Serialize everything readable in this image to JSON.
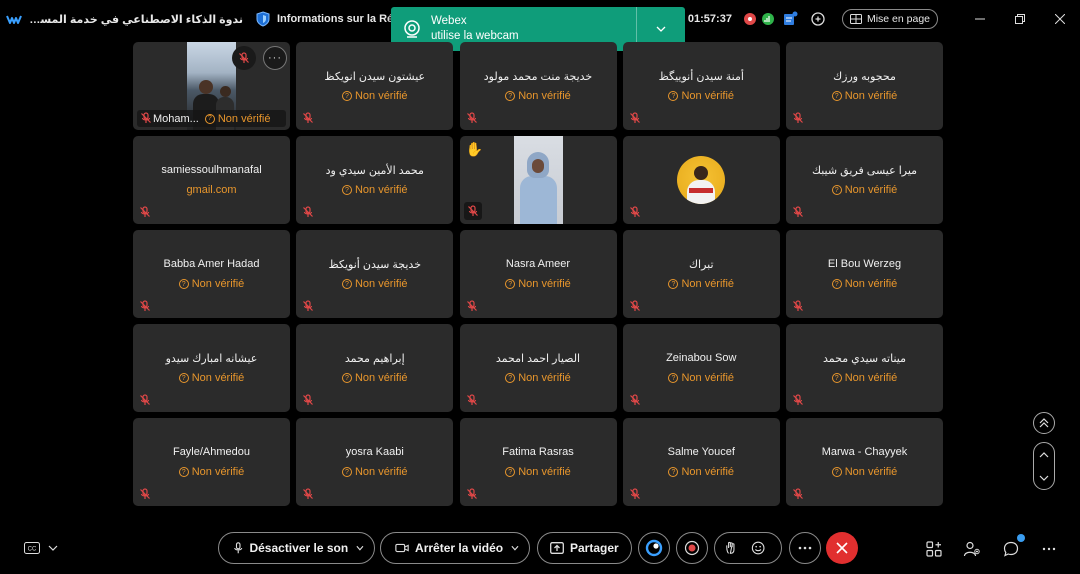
{
  "titlebar": {
    "meeting_title": "ندوة الذكاء الاصطناعي في خدمة المساواة: آفاق المن...",
    "info_label": "Informations sur la Réunion",
    "clock": "01:57:37",
    "layout_label": "Mise en page"
  },
  "toast": {
    "title": "Webex",
    "message": "utilise la webcam"
  },
  "status_text": "Non vérifié",
  "tiles": [
    {
      "name": "Moham...",
      "status": "Non vérifié",
      "type": "video-host"
    },
    {
      "name": "عيشتون سيدن انويكظ",
      "status": "Non vérifié"
    },
    {
      "name": "خديجة منت محمد مولود",
      "status": "Non vérifié"
    },
    {
      "name": "أمنة سيدن أنوييگظ",
      "status": "Non vérifié"
    },
    {
      "name": "محجوبه ورزك",
      "status": "Non vérifié"
    },
    {
      "name": "samiessoulhmanafal",
      "status": "gmail.com",
      "type": "email"
    },
    {
      "name": "محمد الأمين سيدي ود",
      "status": "Non vérifié"
    },
    {
      "name": "",
      "status": "",
      "type": "video-raised"
    },
    {
      "name": "",
      "status": "",
      "type": "avatar"
    },
    {
      "name": "ميرا عيسى فريق شيبك",
      "status": "Non vérifié"
    },
    {
      "name": "Babba Amer Hadad",
      "status": "Non vérifié"
    },
    {
      "name": "خديجة سيدن أنويكظ",
      "status": "Non vérifié"
    },
    {
      "name": "Nasra Ameer",
      "status": "Non vérifié"
    },
    {
      "name": "تبراك",
      "status": "Non vérifié"
    },
    {
      "name": "El Bou Werzeg",
      "status": "Non vérifié"
    },
    {
      "name": "عيشانه امبارك سيدو",
      "status": "Non vérifié"
    },
    {
      "name": "إبراهيم محمد",
      "status": "Non vérifié"
    },
    {
      "name": "الصيار احمد امحمد",
      "status": "Non vérifié"
    },
    {
      "name": "Zeinabou Sow",
      "status": "Non vérifié"
    },
    {
      "name": "ميناته سيدي محمد",
      "status": "Non vérifié"
    },
    {
      "name": "Fayle/Ahmedou",
      "status": "Non vérifié"
    },
    {
      "name": "yosra Kaabi",
      "status": "Non vérifié"
    },
    {
      "name": "Fatima Rasras",
      "status": "Non vérifié"
    },
    {
      "name": "Salme Youcef",
      "status": "Non vérifié"
    },
    {
      "name": "Marwa - Chayyek",
      "status": "Non vérifié"
    }
  ],
  "toolbar": {
    "mute_label": "Désactiver le son",
    "video_label": "Arrêter la vidéo",
    "share_label": "Partager"
  },
  "colors": {
    "toast": "#0f9d7a",
    "tile": "#2b2b2b",
    "status": "#e8962c",
    "end_call": "#e12f2f",
    "mic_muted": "#e04848"
  }
}
